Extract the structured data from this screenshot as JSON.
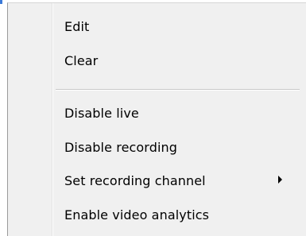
{
  "context_menu": {
    "items": [
      {
        "label": "Edit"
      },
      {
        "label": "Clear"
      },
      {
        "label": "Disable live"
      },
      {
        "label": "Disable recording"
      },
      {
        "label": "Set recording channel",
        "submenu_icon": "chevron-right-icon"
      },
      {
        "label": "Enable video analytics"
      }
    ],
    "colors": {
      "background": "#f0f0f0",
      "text": "#000000",
      "separator": "#c9c9c9",
      "accent": "#3c7ad8"
    }
  }
}
